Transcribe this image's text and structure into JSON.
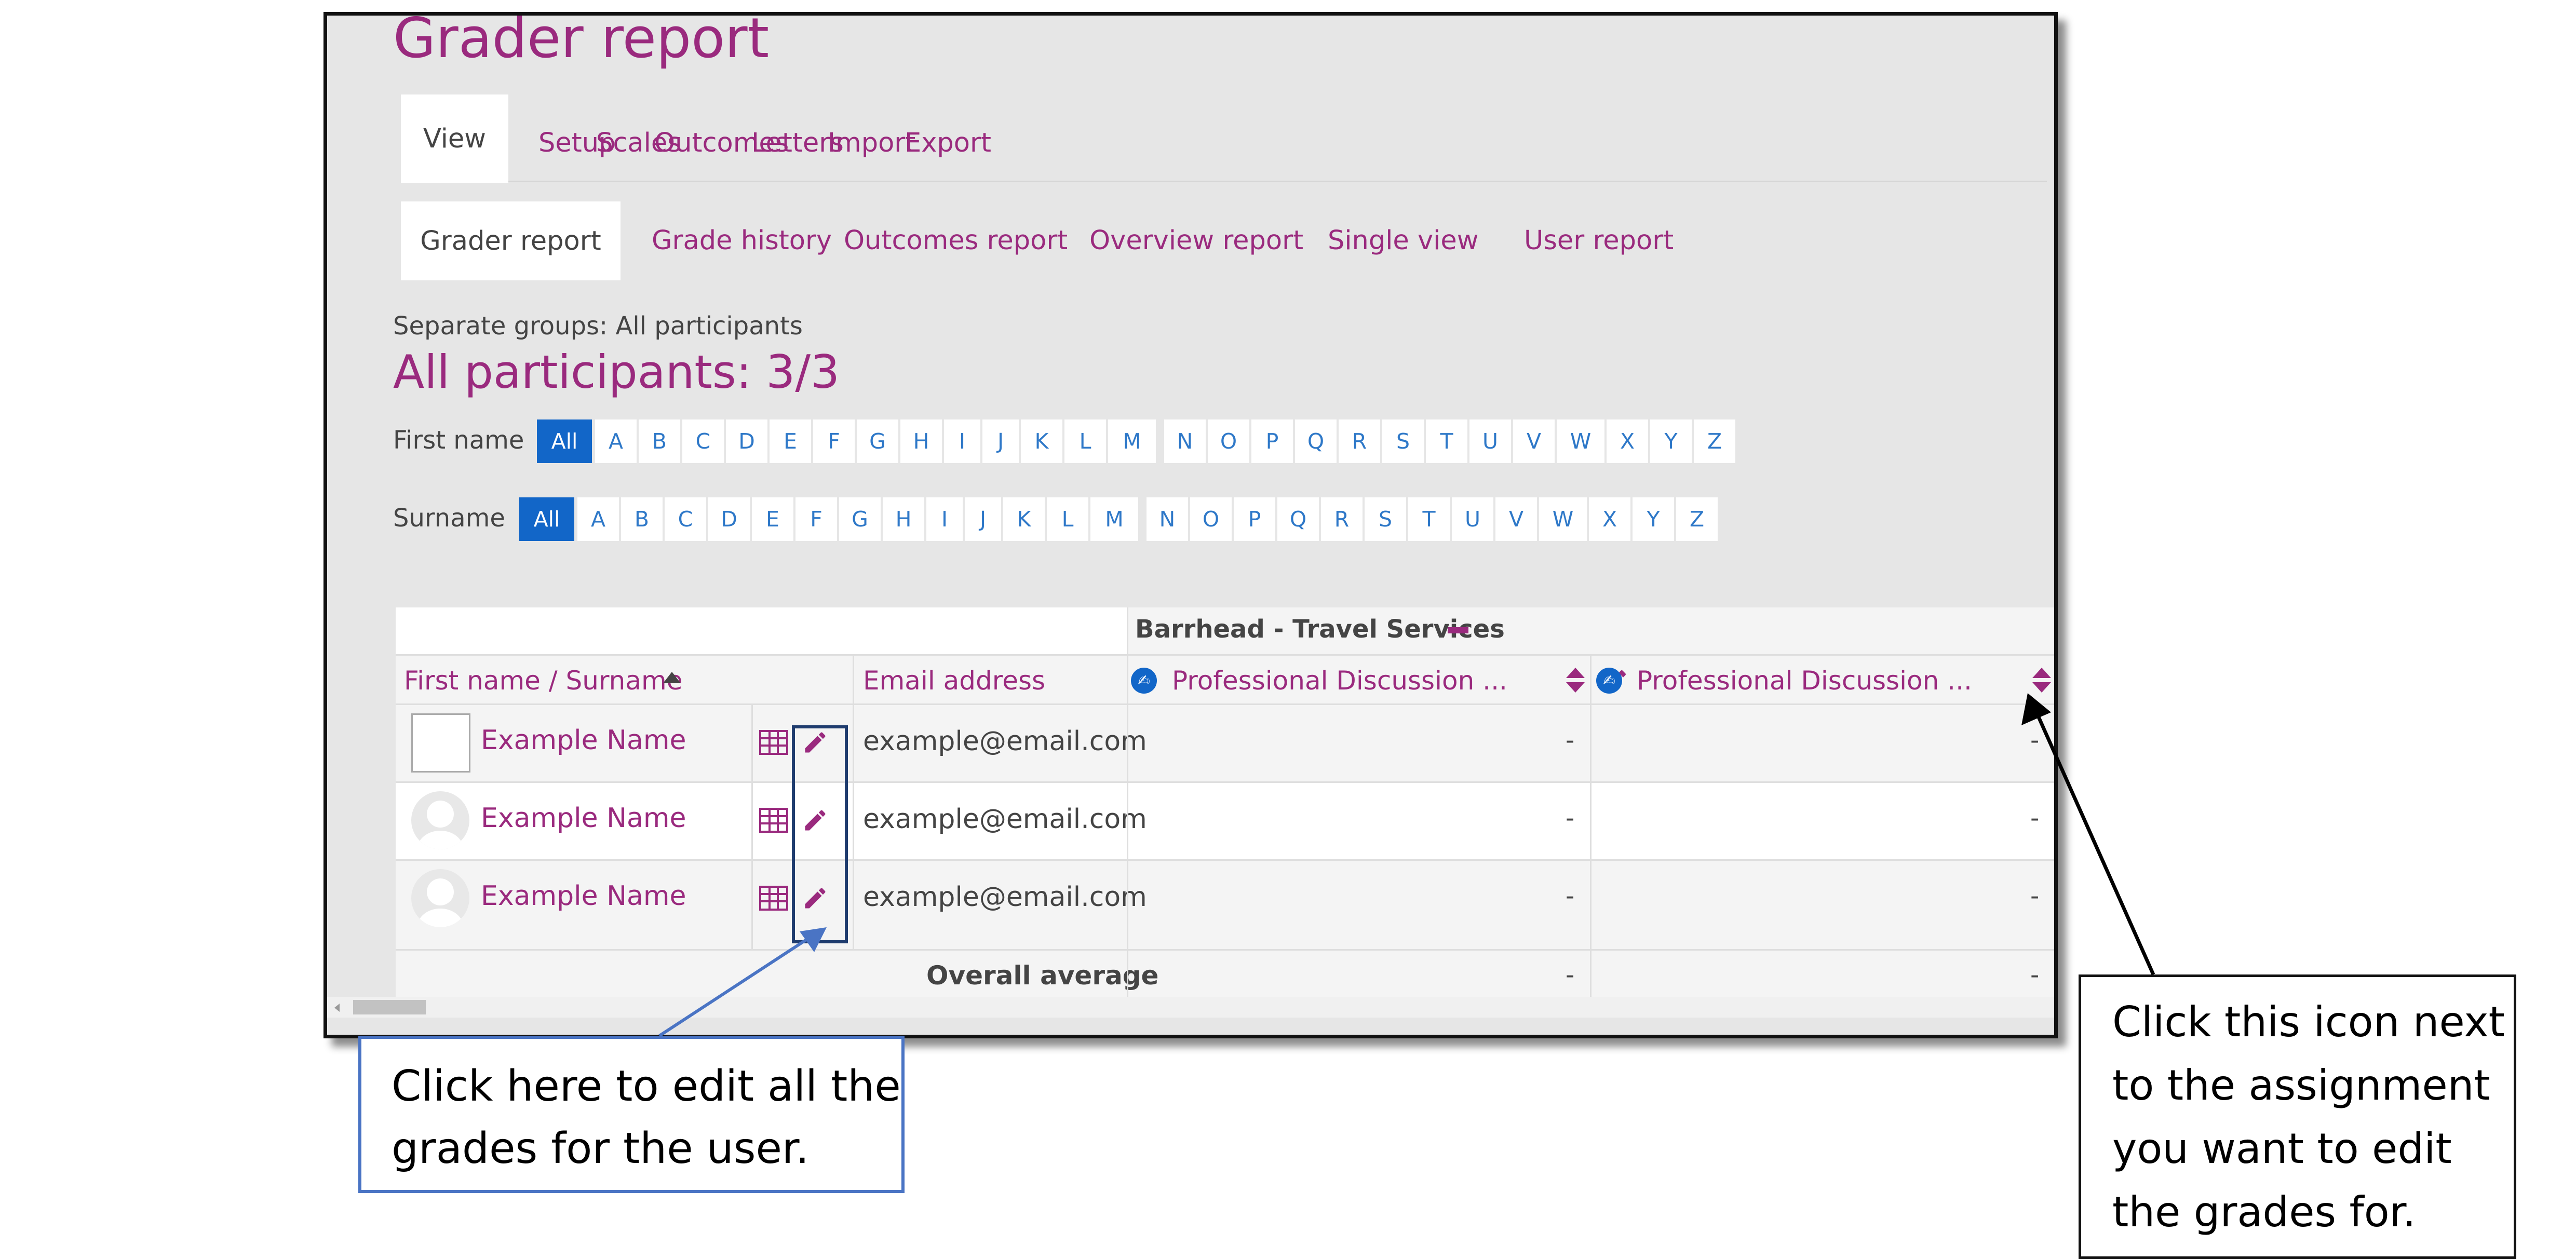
{
  "page": {
    "title": "Grader report"
  },
  "tabs_primary": [
    "View",
    "Setup",
    "Scales",
    "Outcomes",
    "Letters",
    "Import",
    "Export"
  ],
  "tabs_secondary": [
    "Grader report",
    "Grade history",
    "Outcomes report",
    "Overview report",
    "Single view",
    "User report"
  ],
  "groups": {
    "label": "Separate groups: All participants",
    "count_heading": "All participants: 3/3"
  },
  "filters": {
    "first_name_label": "First name",
    "surname_label": "Surname",
    "all_label": "All",
    "letters": [
      "A",
      "B",
      "C",
      "D",
      "E",
      "F",
      "G",
      "H",
      "I",
      "J",
      "K",
      "L",
      "M",
      "N",
      "O",
      "P",
      "Q",
      "R",
      "S",
      "T",
      "U",
      "V",
      "W",
      "X",
      "Y",
      "Z"
    ]
  },
  "table": {
    "category": "Barrhead - Travel Services",
    "col_name": "First name / Surname",
    "col_email": "Email address",
    "col_assign1": "Professional Discussion ...",
    "col_assign2": "Professional Discussion ...",
    "rows": [
      {
        "name": "Example Name",
        "email": "example@email.com",
        "g1": "-",
        "g2": "-"
      },
      {
        "name": "Example Name",
        "email": "example@email.com",
        "g1": "-",
        "g2": "-"
      },
      {
        "name": "Example Name",
        "email": "example@email.com",
        "g1": "-",
        "g2": "-"
      }
    ],
    "overall_label": "Overall average",
    "overall_g1": "-",
    "overall_g2": "-"
  },
  "callouts": {
    "left_line1": "Click here to edit all the",
    "left_line2": "grades for the user.",
    "right_line1": "Click this icon next",
    "right_line2": "to the assignment",
    "right_line3": "you want to edit",
    "right_line4": "the grades for."
  },
  "colors": {
    "accent": "#9a2a7e",
    "link_blue": "#2e78c8",
    "active_blue": "#1266c8",
    "callout_border": "#4a74c4"
  }
}
